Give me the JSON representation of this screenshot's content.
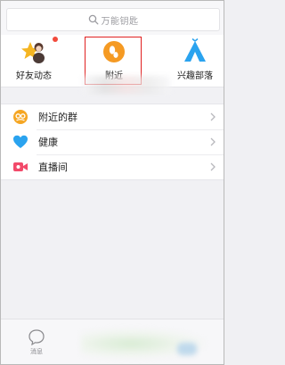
{
  "search": {
    "placeholder": "万能钥匙"
  },
  "shortcuts": [
    {
      "label": "好友动态",
      "icon": "friends-feed-icon"
    },
    {
      "label": "附近",
      "icon": "nearby-icon"
    },
    {
      "label": "兴趣部落",
      "icon": "tribe-icon"
    }
  ],
  "list": [
    {
      "label": "附近的群",
      "icon": "nearby-groups-icon",
      "color": "#f5a623"
    },
    {
      "label": "健康",
      "icon": "health-heart-icon",
      "color": "#2aa3ef"
    },
    {
      "label": "直播间",
      "icon": "live-room-icon",
      "color": "#f24a6a"
    }
  ],
  "tabbar": {
    "message_label": "消息"
  },
  "colors": {
    "highlight": "#e02020",
    "nearby": "#f59a23",
    "tribe": "#2aa3ef"
  }
}
